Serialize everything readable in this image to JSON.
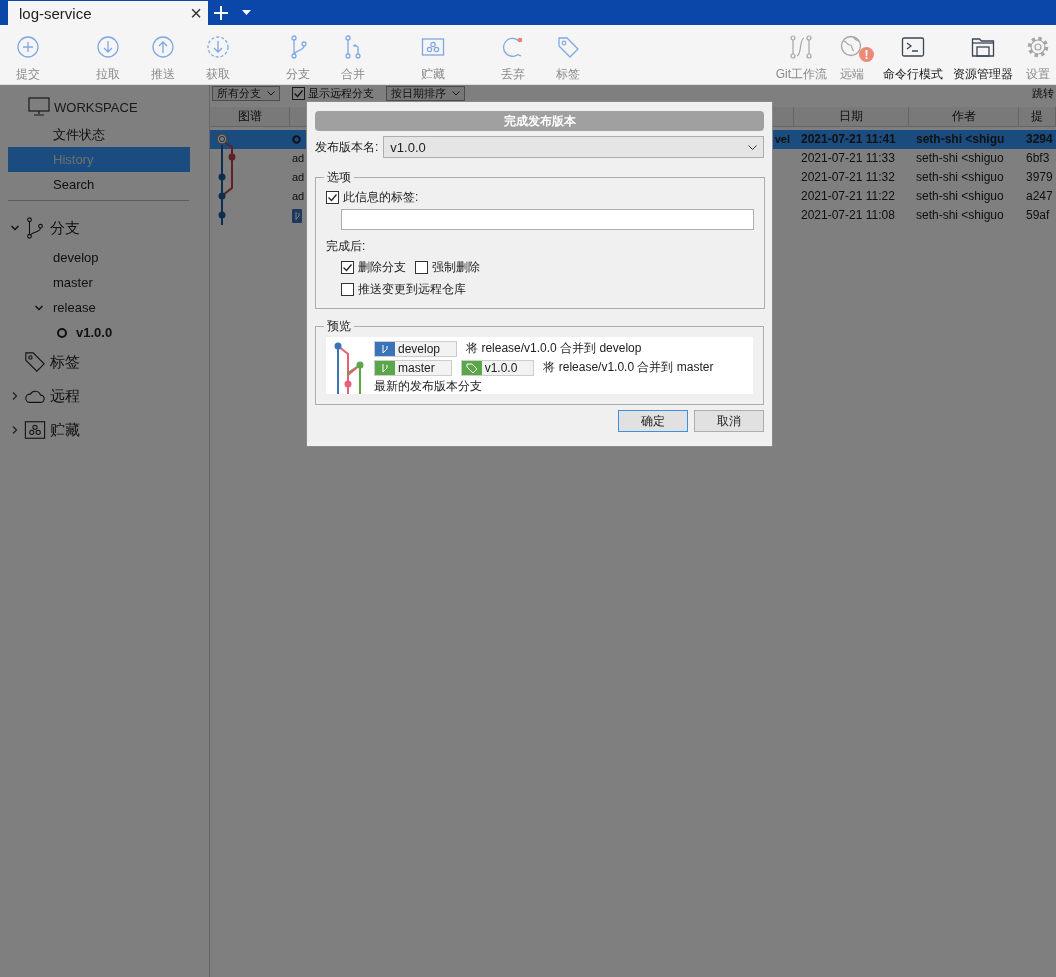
{
  "tabs": [
    {
      "label": "log-service",
      "selected": true,
      "close": "×"
    }
  ],
  "toolbar": {
    "groups": [
      [
        {
          "label": "提交",
          "kind": "commit",
          "disabled": true
        }
      ],
      [
        {
          "label": "拉取",
          "kind": "pull",
          "disabled": true
        },
        {
          "label": "推送",
          "kind": "push",
          "disabled": true
        },
        {
          "label": "获取",
          "kind": "fetch",
          "disabled": true
        }
      ],
      [
        {
          "label": "分支",
          "kind": "branch",
          "disabled": true
        },
        {
          "label": "合并",
          "kind": "merge",
          "disabled": true
        }
      ],
      [
        {
          "label": "贮藏",
          "kind": "stash",
          "disabled": true
        }
      ],
      [
        {
          "label": "丢弃",
          "kind": "discard",
          "disabled": true
        },
        {
          "label": "标签",
          "kind": "tag",
          "disabled": true
        }
      ]
    ],
    "right": [
      {
        "label": "Git工作流",
        "kind": "gitflow",
        "disabled": true
      },
      {
        "label": "远端",
        "kind": "remote",
        "disabled": true,
        "badge": "!"
      },
      {
        "label": "命令行模式",
        "kind": "terminal",
        "disabled": false
      },
      {
        "label": "资源管理器",
        "kind": "explorer",
        "disabled": false
      },
      {
        "label": "设置",
        "kind": "settings",
        "disabled": true
      }
    ]
  },
  "sidebar": {
    "workspace": {
      "title": "WORKSPACE",
      "items": [
        {
          "label": "文件状态",
          "selected": false
        },
        {
          "label": "History",
          "selected": true
        },
        {
          "label": "Search",
          "selected": false
        }
      ]
    },
    "sections": [
      {
        "label": "分支",
        "kind": "branch",
        "expanded": true,
        "children": [
          {
            "label": "develop",
            "current": false
          },
          {
            "label": "master",
            "current": false
          },
          {
            "label": "release",
            "expanded": true,
            "children": [
              {
                "label": "v1.0.0",
                "current": true
              }
            ]
          }
        ]
      },
      {
        "label": "标签",
        "kind": "tag"
      },
      {
        "label": "远程",
        "kind": "cloud",
        "expanded": false
      },
      {
        "label": "贮藏",
        "kind": "stash",
        "expanded": false
      }
    ]
  },
  "filter_bar": {
    "branch_filter": "所有分支",
    "show_remote": {
      "label": "显示远程分支",
      "checked": true
    },
    "sort": "按日期排序",
    "jump": "跳转"
  },
  "history": {
    "columns": {
      "graph": "图谱",
      "date": "日期",
      "author": "作者",
      "hash": "提"
    },
    "rows": [
      {
        "kind": "head",
        "selected": true,
        "message_tail": "vel",
        "date": "2021-07-21 11:41",
        "author": "seth-shi <shigu",
        "hash": "3294"
      },
      {
        "kind": "plain",
        "selected": false,
        "message": "ad",
        "date": "2021-07-21 11:33",
        "author": "seth-shi <shiguo",
        "hash": "6bf3"
      },
      {
        "kind": "plain",
        "selected": false,
        "message": "ad",
        "date": "2021-07-21 11:32",
        "author": "seth-shi <shiguo",
        "hash": "3979"
      },
      {
        "kind": "plain",
        "selected": false,
        "message": "ad",
        "date": "2021-07-21 11:22",
        "author": "seth-shi <shiguo",
        "hash": "a247"
      },
      {
        "kind": "label",
        "selected": false,
        "date": "2021-07-21 11:08",
        "author": "seth-shi <shiguo",
        "hash": "59af"
      }
    ]
  },
  "dialog": {
    "title": "完成发布版本",
    "version_label": "发布版本名:",
    "version": "v1.0.0",
    "options": {
      "legend": "选项",
      "tag_message": {
        "label": "此信息的标签:",
        "checked": true
      },
      "after_label": "完成后:",
      "after": [
        [
          {
            "label": "删除分支",
            "checked": true
          },
          {
            "label": "强制删除",
            "checked": false
          }
        ],
        [
          {
            "label": "推送变更到远程仓库",
            "checked": false
          }
        ]
      ]
    },
    "preview": {
      "legend": "预览",
      "lines": [
        {
          "refs": [
            {
              "kind": "branch",
              "label": "develop",
              "color": "#3b73b9"
            }
          ],
          "text": "将 release/v1.0.0 合并到 develop"
        },
        {
          "refs": [
            {
              "kind": "branch",
              "label": "master",
              "color": "#5aa74a"
            },
            {
              "kind": "tag",
              "label": "v1.0.0",
              "color": "#5aa74a"
            }
          ],
          "text": "将 release/v1.0.0 合并到 master"
        },
        {
          "text": "最新的发布版本分支"
        }
      ]
    },
    "buttons": [
      {
        "label": "确定",
        "default": true
      },
      {
        "label": "取消",
        "default": false
      }
    ]
  }
}
